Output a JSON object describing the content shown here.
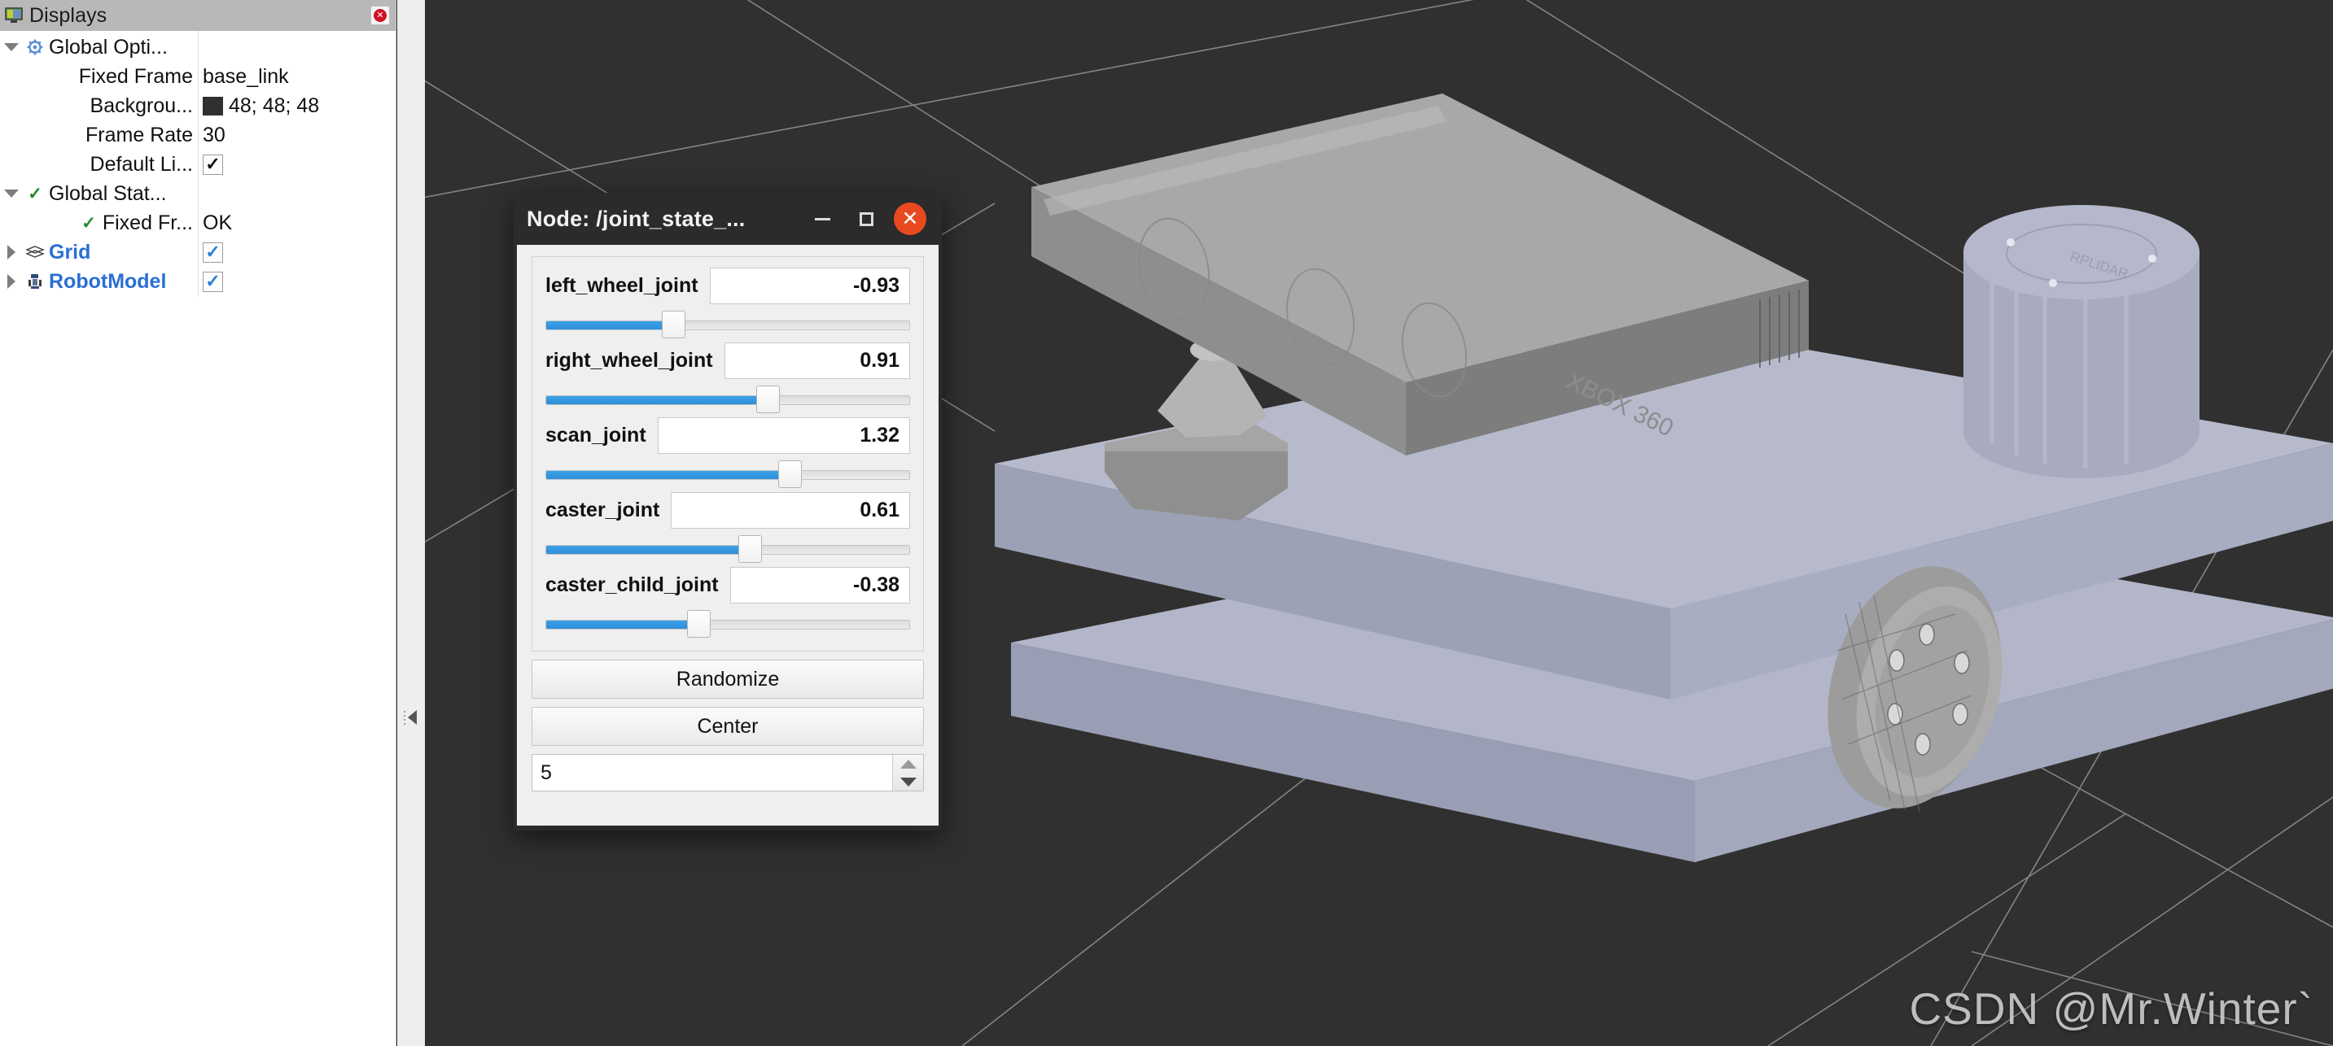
{
  "displays_panel": {
    "title": "Displays",
    "icon": "monitor-icon",
    "close_icon": "close-icon",
    "column_separator": true,
    "tree": [
      {
        "label": "Global Opti...",
        "icon": "gear-icon",
        "expander": "down",
        "depth": 0,
        "value_type": "none",
        "value": ""
      },
      {
        "label": "Fixed Frame",
        "icon": "none",
        "expander": "none",
        "depth": 1,
        "value_type": "text",
        "value": "base_link"
      },
      {
        "label": "Backgrou...",
        "icon": "none",
        "expander": "none",
        "depth": 1,
        "value_type": "color",
        "value": "48; 48; 48",
        "swatch_color": "#303030"
      },
      {
        "label": "Frame Rate",
        "icon": "none",
        "expander": "none",
        "depth": 1,
        "value_type": "text",
        "value": "30"
      },
      {
        "label": "Default Li...",
        "icon": "none",
        "expander": "none",
        "depth": 1,
        "value_type": "checkbox-black",
        "value": "✓"
      },
      {
        "label": "Global Stat...",
        "icon": "green-check-icon",
        "expander": "down",
        "depth": 0,
        "value_type": "none",
        "value": ""
      },
      {
        "label": "Fixed Fr...",
        "icon": "green-check-icon",
        "expander": "none",
        "depth": 2,
        "value_type": "text",
        "value": "OK"
      },
      {
        "label": "Grid",
        "icon": "grid-icon",
        "expander": "right",
        "depth": 0,
        "value_type": "checkbox-blue",
        "value": "✓",
        "highlight": true
      },
      {
        "label": "RobotModel",
        "icon": "robot-icon",
        "expander": "right",
        "depth": 0,
        "value_type": "checkbox-blue",
        "value": "✓",
        "highlight": true
      }
    ]
  },
  "splitter": {
    "collapse_icon": "triangle-left-icon"
  },
  "joint_dialog": {
    "title": "Node: /joint_state_...",
    "window_buttons": {
      "minimize": "minimize-icon",
      "maximize": "maximize-icon",
      "close": "close-icon"
    },
    "joints": [
      {
        "name": "left_wheel_joint",
        "value": "-0.93",
        "slider_percent": 35
      },
      {
        "name": "right_wheel_joint",
        "value": "0.91",
        "slider_percent": 61
      },
      {
        "name": "scan_joint",
        "value": "1.32",
        "slider_percent": 67
      },
      {
        "name": "caster_joint",
        "value": "0.61",
        "slider_percent": 56
      },
      {
        "name": "caster_child_joint",
        "value": "-0.38",
        "slider_percent": 42
      }
    ],
    "randomize_label": "Randomize",
    "center_label": "Center",
    "spin_value": "5",
    "spin_up_icon": "caret-up-icon",
    "spin_down_icon": "caret-down-icon"
  },
  "viewport": {
    "background_color": "#303030",
    "grid_color": "#9a9a9a",
    "robot": {
      "base_plate_color": "#b3b6c8",
      "sensor_color": "#8e8e8e",
      "lidar_color": "#a8abc0",
      "wheel_color": "#9c9c9c",
      "parts": [
        "upper-plate",
        "lower-plate",
        "kinect-sensor",
        "kinect-stand",
        "lidar-cylinder",
        "right-wheel"
      ]
    }
  },
  "watermark": {
    "text": "CSDN @Mr.Winter`"
  }
}
